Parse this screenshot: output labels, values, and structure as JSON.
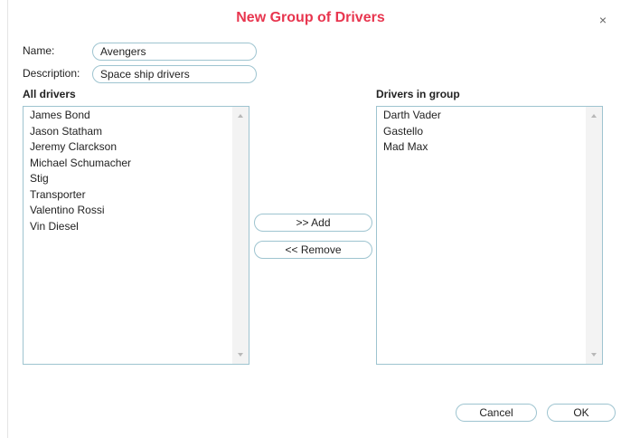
{
  "dialog": {
    "title": "New Group of Drivers",
    "close_glyph": "×"
  },
  "form": {
    "name_label": "Name:",
    "name_value": "Avengers",
    "description_label": "Description:",
    "description_value": "Space ship drivers"
  },
  "all_drivers": {
    "title": "All drivers",
    "items": [
      "James Bond",
      "Jason Statham",
      "Jeremy Clarckson",
      "Michael Schumacher",
      "Stig",
      "Transporter",
      "Valentino Rossi",
      "Vin Diesel"
    ]
  },
  "group_drivers": {
    "title": "Drivers in group",
    "items": [
      "Darth Vader",
      "Gastello",
      "Mad Max"
    ]
  },
  "actions": {
    "add_label": ">> Add",
    "remove_label": "<< Remove"
  },
  "footer": {
    "cancel_label": "Cancel",
    "ok_label": "OK"
  }
}
